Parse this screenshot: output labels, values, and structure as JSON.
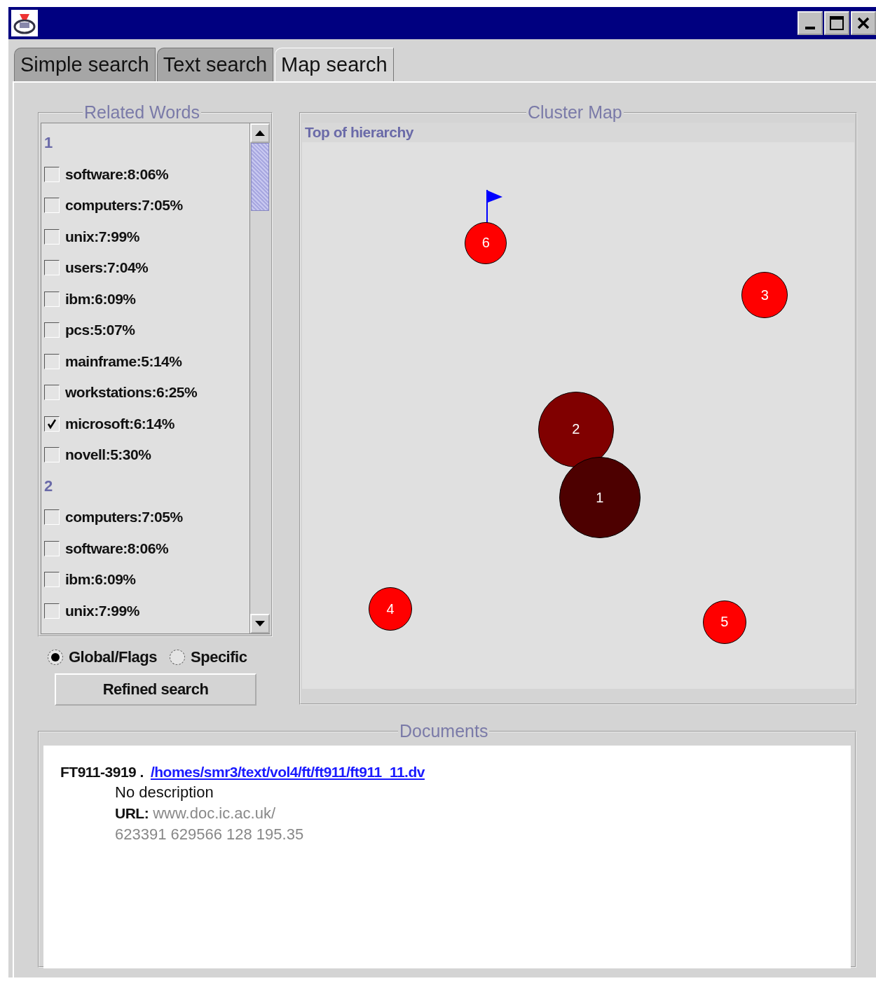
{
  "tabs": [
    {
      "label": "Simple search",
      "selected": false
    },
    {
      "label": "Text search",
      "selected": false
    },
    {
      "label": "Map search",
      "selected": true
    }
  ],
  "related_words": {
    "title": "Related Words",
    "groups": [
      {
        "label": "1",
        "words": [
          {
            "label": "software:8:06%",
            "checked": false
          },
          {
            "label": "computers:7:05%",
            "checked": false
          },
          {
            "label": "unix:7:99%",
            "checked": false
          },
          {
            "label": "users:7:04%",
            "checked": false
          },
          {
            "label": "ibm:6:09%",
            "checked": false
          },
          {
            "label": "pcs:5:07%",
            "checked": false
          },
          {
            "label": "mainframe:5:14%",
            "checked": false
          },
          {
            "label": "workstations:6:25%",
            "checked": false
          },
          {
            "label": "microsoft:6:14%",
            "checked": true
          },
          {
            "label": "novell:5:30%",
            "checked": false
          }
        ]
      },
      {
        "label": "2",
        "words": [
          {
            "label": "computers:7:05%",
            "checked": false
          },
          {
            "label": "software:8:06%",
            "checked": false
          },
          {
            "label": "ibm:6:09%",
            "checked": false
          },
          {
            "label": "unix:7:99%",
            "checked": false
          }
        ]
      }
    ]
  },
  "scope_options": [
    {
      "label": "Global/Flags",
      "selected": true
    },
    {
      "label": "Specific",
      "selected": false
    }
  ],
  "refine_button": "Refined search",
  "cluster_map": {
    "title": "Cluster Map",
    "heading": "Top of hierarchy",
    "clusters": [
      {
        "label": "6",
        "color": "#ff0000",
        "flagged": true
      },
      {
        "label": "3",
        "color": "#ff0000",
        "flagged": false
      },
      {
        "label": "2",
        "color": "#800000",
        "flagged": false
      },
      {
        "label": "1",
        "color": "#4d0000",
        "flagged": false
      },
      {
        "label": "4",
        "color": "#ff0000",
        "flagged": false
      },
      {
        "label": "5",
        "color": "#ff0000",
        "flagged": false
      }
    ]
  },
  "documents": {
    "title": "Documents",
    "results": [
      {
        "id": "FT911-3919 .",
        "path": "/homes/smr3/text/vol4/ft/ft911/ft911_11.dv",
        "description": "No description",
        "url_label": "URL:",
        "url": "www.doc.ic.ac.uk/",
        "stats": "623391 629566 128 195.35"
      }
    ]
  }
}
